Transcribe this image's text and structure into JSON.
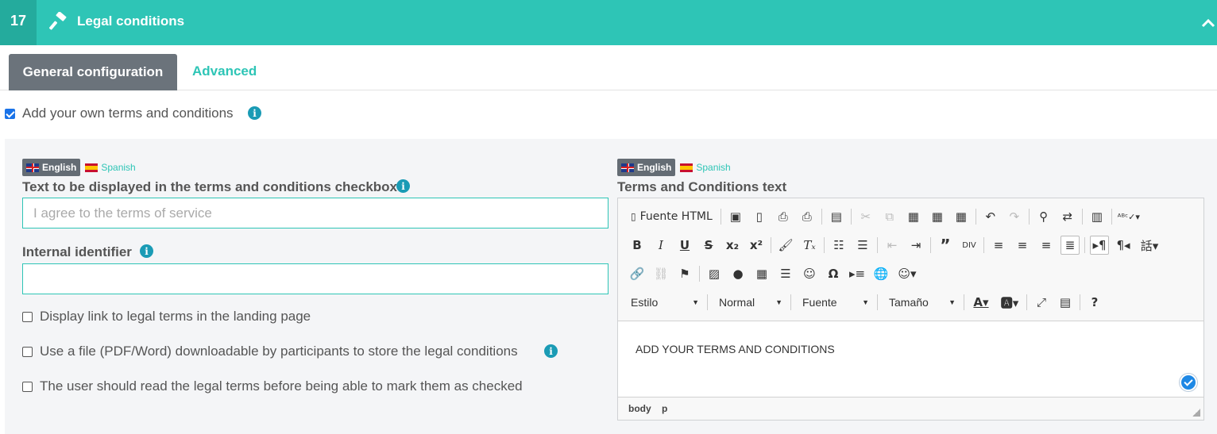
{
  "header": {
    "step_number": "17",
    "icon": "hammer-icon",
    "title": "Legal conditions",
    "collapse_icon": "chevron-up-icon",
    "color": "#2ec5b6"
  },
  "tabs": [
    {
      "label": "General configuration",
      "active": true
    },
    {
      "label": "Advanced",
      "active": false
    }
  ],
  "own_terms": {
    "label": "Add your own terms and conditions",
    "checked": true
  },
  "left": {
    "languages": {
      "active": "English",
      "other": "Spanish"
    },
    "checkbox_text": {
      "title": "Text to be displayed in the terms and conditions checkbox",
      "placeholder": "I agree to the terms of service",
      "value": ""
    },
    "internal_id": {
      "title": "Internal identifier",
      "value": ""
    },
    "options": [
      {
        "label": "Display link to legal terms in the landing page",
        "checked": false
      },
      {
        "label": "Use a file (PDF/Word) downloadable by participants to store the legal conditions",
        "checked": false
      },
      {
        "label": "The user should read the legal terms before being able to mark them as checked",
        "checked": false
      }
    ]
  },
  "right": {
    "languages": {
      "active": "English",
      "other": "Spanish"
    },
    "title": "Terms and Conditions text",
    "editor": {
      "source_label": "Fuente HTML",
      "combos": [
        "Estilo",
        "Normal",
        "Fuente",
        "Tamaño"
      ],
      "content": "ADD YOUR TERMS AND CONDITIONS",
      "path": [
        "body",
        "p"
      ]
    }
  }
}
